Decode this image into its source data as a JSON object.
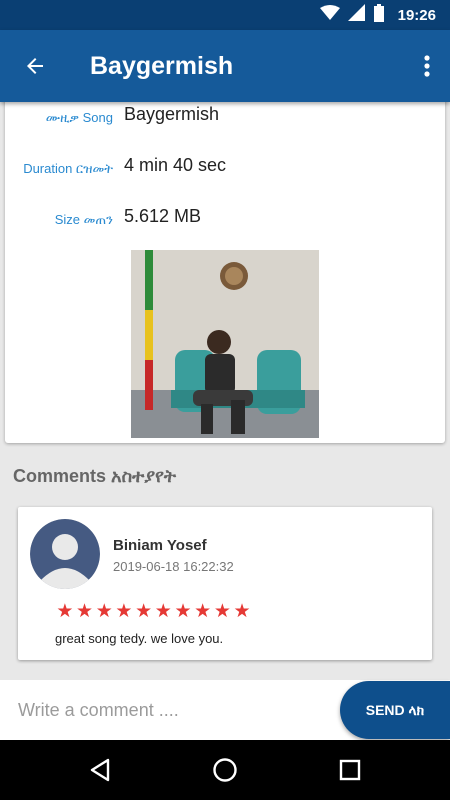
{
  "status_bar": {
    "time": "19:26",
    "icons": [
      "wifi-icon",
      "signal-icon",
      "battery-icon"
    ]
  },
  "app_bar": {
    "title": "Baygermish",
    "back_icon": "arrow-left-icon",
    "menu_icon": "more-vert-icon"
  },
  "details": {
    "rows": [
      {
        "label": "ሙዚቃ Song",
        "value": "Baygermish"
      },
      {
        "label": "Duration ርዝመት",
        "value": "4 min 40 sec"
      },
      {
        "label": "Size መጠን",
        "value": "5.612 MB"
      }
    ]
  },
  "comments": {
    "heading": "Comments አስተያየት",
    "items": [
      {
        "author": "Biniam Yosef",
        "date": "2019-06-18 16:22:32",
        "rating": 10,
        "text": "great song tedy. we love you."
      }
    ]
  },
  "input_bar": {
    "placeholder": "Write a comment ....",
    "send_label": "SEND ላክ"
  },
  "colors": {
    "status_bar": "#0a3f73",
    "app_bar": "#155a9a",
    "accent": "#2a8ad0",
    "send_button": "#0e4f8c",
    "star": "#e53935"
  }
}
